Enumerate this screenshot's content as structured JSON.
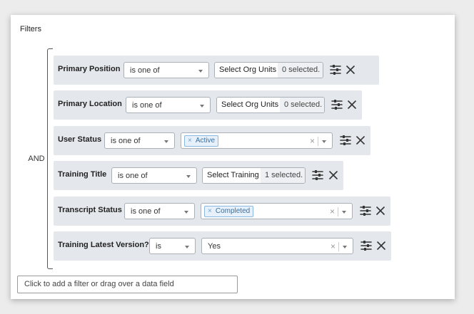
{
  "panel": {
    "title": "Filters",
    "logic_operator": "AND",
    "add_filter_placeholder": "Click to add a filter or drag over a data field"
  },
  "filters": [
    {
      "field": "Primary Position",
      "operator": "is one of",
      "button": "Select Org Units",
      "count": "0 selected."
    },
    {
      "field": "Primary Location",
      "operator": "is one of",
      "button": "Select Org Units",
      "count": "0 selected."
    },
    {
      "field": "User Status",
      "operator": "is one of",
      "tags": [
        "Active"
      ]
    },
    {
      "field": "Training Title",
      "operator": "is one of",
      "button": "Select Training",
      "count": "1 selected."
    },
    {
      "field": "Transcript Status",
      "operator": "is one of",
      "tags": [
        "Completed"
      ]
    },
    {
      "field": "Training Latest Version?",
      "operator": "is",
      "value": "Yes"
    }
  ],
  "icons": {
    "settings": "sliders-icon",
    "remove": "close-icon",
    "tag_remove": "×",
    "clear": "×"
  },
  "colors": {
    "row_background": "#e4e7ec",
    "tag_background": "#e6f1fb",
    "tag_border": "#8ab8df",
    "tag_text": "#3a6fa0"
  }
}
